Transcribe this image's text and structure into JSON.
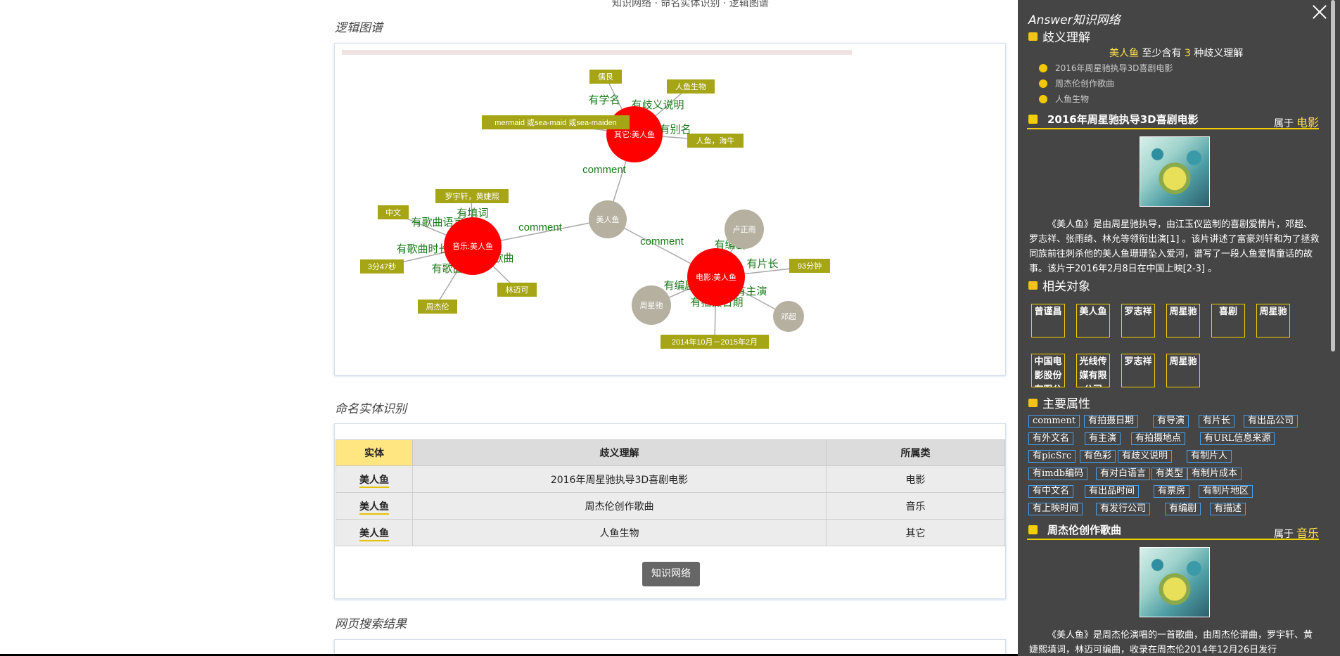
{
  "top_cut_text": "知识网络 · 命名实体识别 · 逻辑图谱",
  "sections": {
    "graph_title": "逻辑图谱",
    "ner_title": "命名实体识别",
    "search_title": "网页搜索结果"
  },
  "graph": {
    "nodes": {
      "center": "美人鱼",
      "other": "其它:美人鱼",
      "music": "音乐:美人鱼",
      "movie": "电影:美人鱼",
      "lu": "卢正雨",
      "zhou": "周星驰",
      "deng": "邓超"
    },
    "edges": {
      "c_other": "comment",
      "c_music": "comment",
      "c_movie": "comment",
      "o1": "有学名",
      "o2": "有歧义说明",
      "o3": "有别名",
      "m1": "有填词",
      "m2": "有歌曲语言",
      "m3": "有歌曲时长",
      "m4": "有歌曲",
      "m5": "有歌曲",
      "v1": "有编剧",
      "v2": "有片长",
      "v3": "有编剧",
      "v4": "有主演",
      "v5": "有拍摄日期"
    },
    "tags": {
      "o1": "儒艮",
      "o2": "人鱼生物",
      "o3": "mermaid 或sea-maid 或sea-maiden",
      "o4": "人鱼，海牛",
      "m1": "罗宇轩，黄婕熙",
      "m2": "中文",
      "m3": "3分47秒",
      "m4": "周杰伦",
      "m5": "林迈可",
      "v1": "93分钟",
      "v2": "2014年10月－2015年2月"
    }
  },
  "ner": {
    "headers": [
      "实体",
      "歧义理解",
      "所属类"
    ],
    "rows": [
      {
        "entity": "美人鱼",
        "meaning": "2016年周星驰执导3D喜剧电影",
        "category": "电影"
      },
      {
        "entity": "美人鱼",
        "meaning": "周杰伦创作歌曲",
        "category": "音乐"
      },
      {
        "entity": "美人鱼",
        "meaning": "人鱼生物",
        "category": "其它"
      }
    ],
    "button": "知识网络"
  },
  "drawer": {
    "title": "Answer知识网络",
    "ambiguity_heading": "歧义理解",
    "summary": {
      "entity": "美人鱼",
      "pre": "至少含有",
      "count": "3",
      "post": "种歧义理解"
    },
    "senses_list": [
      "2016年周星驰执导3D喜剧电影",
      "周杰伦创作歌曲",
      "人鱼生物"
    ],
    "sense1": {
      "title": "2016年周星驰执导3D喜剧电影",
      "belong_label": "属于",
      "category": "电影",
      "description": "《美人鱼》是由周星驰执导，由江玉仪监制的喜剧爱情片，邓超、罗志祥、张雨绮、林允等领衔出演[1] 。该片讲述了富豪刘轩和为了拯救同族前往刺杀他的美人鱼珊珊坠入爱河，谱写了一段人鱼爱情童话的故事。该片于2016年2月8日在中国上映[2-3] 。"
    },
    "related_heading": "相关对象",
    "related": [
      "曾谨昌",
      "美人鱼",
      "罗志祥",
      "周星驰",
      "喜剧",
      "周星驰",
      "中国电影股份有限公司",
      "光线传媒有限公司",
      "罗志祥",
      "周星驰"
    ],
    "attrs_heading": "主要属性",
    "attrs": [
      "comment",
      "有拍摄日期",
      "有导演",
      "有片长",
      "有出品公司",
      "有外文名",
      "有主演",
      "有拍摄地点",
      "有URL信息来源",
      "有picSrc",
      "有色彩",
      "有歧义说明",
      "有制片人",
      "有imdb编码",
      "有对白语言",
      "有类型",
      "有制片成本",
      "有中文名",
      "有出品时间",
      "有票房",
      "有制片地区",
      "有上映时间",
      "有发行公司",
      "有编剧",
      "有描述"
    ],
    "sense2": {
      "title": "周杰伦创作歌曲",
      "belong_label": "属于",
      "category": "音乐",
      "description": "《美人鱼》是周杰伦演唱的一首歌曲，由周杰伦谱曲，罗宇轩、黄婕熙填词，林迈可编曲，收录在周杰伦2014年12月26日发行"
    }
  },
  "colors": {
    "entity_red": "#ff0000",
    "neutral_node": "#b5b0a0",
    "tag_olive": "#a6a516",
    "edge_green": "#1a7a1a",
    "drawer_bg": "#454545",
    "accent_yellow": "#f2d000"
  }
}
